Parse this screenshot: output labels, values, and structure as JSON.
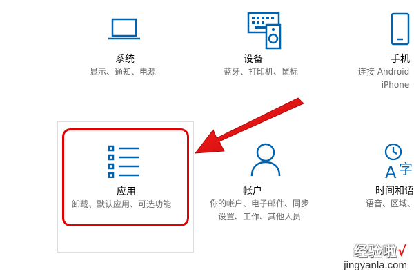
{
  "tiles": {
    "system": {
      "title": "系统",
      "desc": [
        "显示、通知、电源"
      ],
      "icon": "laptop-icon"
    },
    "devices": {
      "title": "设备",
      "desc": [
        "蓝牙、打印机、鼠标"
      ],
      "icon": "keyboard-speaker-icon"
    },
    "phone": {
      "title": "手机",
      "desc": [
        "连接 Android",
        "iPhone"
      ],
      "icon": "phone-icon"
    },
    "apps": {
      "title": "应用",
      "desc": [
        "卸载、默认应用、可选功能"
      ],
      "icon": "list-icon"
    },
    "accounts": {
      "title": "帐户",
      "desc": [
        "你的帐户、电子邮件、同步",
        "设置、工作、其他人员"
      ],
      "icon": "person-icon"
    },
    "time": {
      "title": "时间和语",
      "desc": [
        "语音、区域、"
      ],
      "icon": "clock-language-icon"
    }
  },
  "watermark": {
    "top": "经验啦",
    "check": "√",
    "bottom": "jingyanla.com"
  },
  "colors": {
    "accent": "#0063b1",
    "highlight": "#e00000",
    "text": "#000000",
    "subtext": "#666666"
  }
}
